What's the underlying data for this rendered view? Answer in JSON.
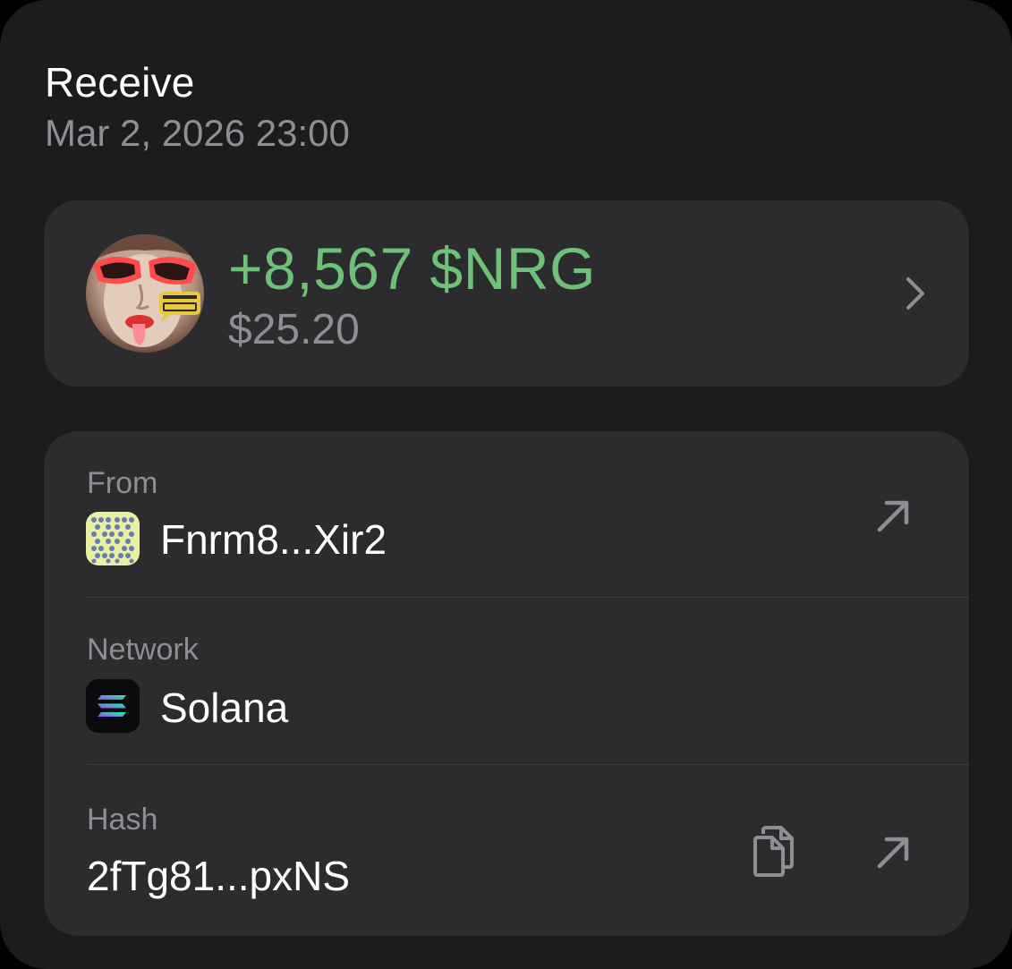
{
  "header": {
    "title": "Receive",
    "datetime": "Mar 2, 2026 23:00"
  },
  "amount_card": {
    "token_icon": "token-avatar-icon",
    "amount": "+8,567 $NRG",
    "fiat_value": "$25.20",
    "amount_color": "#6ec177",
    "chevron_icon": "chevron-right-icon"
  },
  "details": {
    "from": {
      "label": "From",
      "value": "Fnrm8...Xir2",
      "icon": "wallet-identicon-icon",
      "action_icon": "external-link-icon"
    },
    "network": {
      "label": "Network",
      "value": "Solana",
      "icon": "solana-logo-icon"
    },
    "hash": {
      "label": "Hash",
      "value": "2fTg81...pxNS",
      "copy_icon": "copy-icon",
      "action_icon": "external-link-icon"
    }
  },
  "colors": {
    "background": "#1c1c1e",
    "card": "#2c2c2e",
    "secondary_text": "#8e8e93",
    "positive": "#6ec177"
  }
}
